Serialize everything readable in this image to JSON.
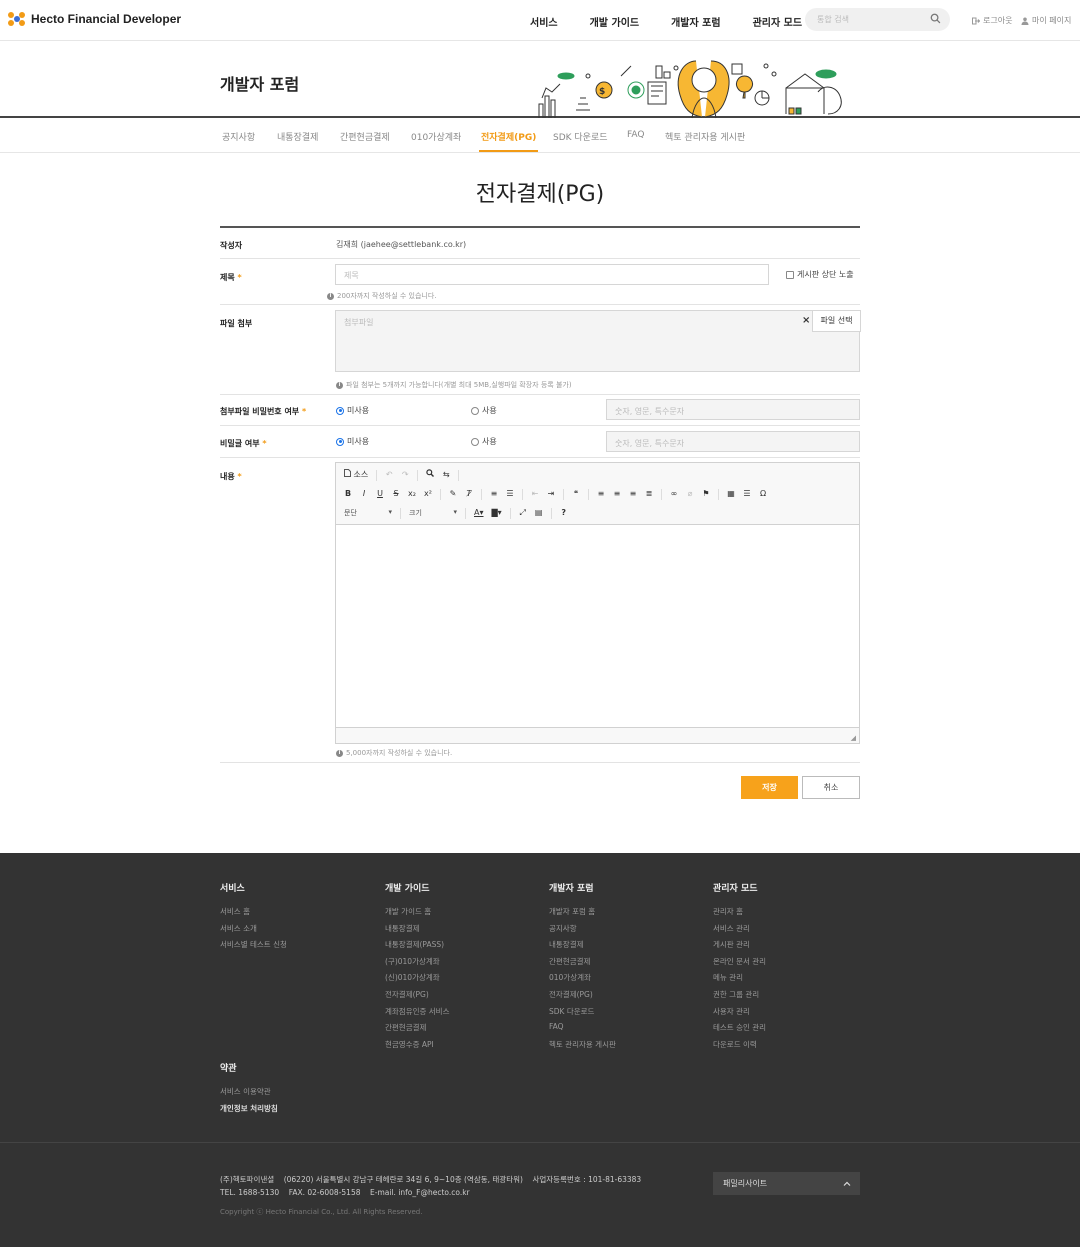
{
  "header": {
    "logo_text": "Hecto Financial Developer",
    "nav": [
      "서비스",
      "개발 가이드",
      "개발자 포럼",
      "관리자 모드"
    ],
    "search_placeholder": "통합 검색",
    "logout": "로그아웃",
    "mypage": "마이 페이지"
  },
  "page_title": "개발자 포럼",
  "tabs": [
    {
      "label": "공지사항",
      "active": false
    },
    {
      "label": "내통장결제",
      "active": false
    },
    {
      "label": "간편현금결제",
      "active": false
    },
    {
      "label": "010가상계좌",
      "active": false
    },
    {
      "label": "전자결제(PG)",
      "active": true
    },
    {
      "label": "SDK 다운로드",
      "active": false
    },
    {
      "label": "FAQ",
      "active": false
    },
    {
      "label": "헥토 관리자용 게시판",
      "active": false
    }
  ],
  "board_title": "전자결제(PG)",
  "form": {
    "author_label": "작성자",
    "author_value": "김재희 (jaehee@settlebank.co.kr)",
    "title_label": "제목",
    "title_placeholder": "제목",
    "notice_top_label": "게시판 상단 노출",
    "title_hint": "200자까지 작성하실 수 있습니다.",
    "file_label": "파일 첨부",
    "file_placeholder": "첨부파일",
    "file_select": "파일 선택",
    "file_clear": "×",
    "file_hint": "파일 첨부는 5개까지 가능합니다(개별 최대 5MB,실행파일 확장자 등록 불가)",
    "file_pw_label": "첨부파일 비밀번호 여부",
    "file_pw_off": "미사용",
    "file_pw_on": "사용",
    "file_pw_placeholder": "숫자, 영문, 특수문자",
    "secret_label": "비밀글 여부",
    "secret_off": "미사용",
    "secret_on": "사용",
    "secret_placeholder": "숫자, 영문, 특수문자",
    "content_label": "내용",
    "content_hint": "5,000자까지 작성하실 수 있습니다.",
    "required_mark": "*"
  },
  "editor": {
    "source": "소스",
    "format_select": "문단",
    "size_select": "크기"
  },
  "buttons": {
    "save": "저장",
    "cancel": "취소"
  },
  "footer": {
    "columns": [
      {
        "title": "서비스",
        "links": [
          "서비스 홈",
          "서비스 소개",
          "서비스별 테스트 신청"
        ]
      },
      {
        "title": "개발 가이드",
        "links": [
          "개발 가이드 홈",
          "내통장결제",
          "내통장결제(PASS)",
          "(구)010가상계좌",
          "(신)010가상계좌",
          "전자결제(PG)",
          "계좌점유인증 서비스",
          "간편현금결제",
          "현금영수증 API"
        ]
      },
      {
        "title": "개발자 포럼",
        "links": [
          "개발자 포럼 홈",
          "공지사항",
          "내통장결제",
          "간편현금결제",
          "010가상계좌",
          "전자결제(PG)",
          "SDK 다운로드",
          "FAQ",
          "헥토 관리자용 게시판"
        ]
      },
      {
        "title": "관리자 모드",
        "links": [
          "관리자 홈",
          "서비스 관리",
          "게시판 관리",
          "온라인 문서 관리",
          "메뉴 관리",
          "권한 그룹 관리",
          "사용자 관리",
          "테스트 승인 관리",
          "다운로드 이력"
        ]
      }
    ],
    "terms_title": "약관",
    "terms_links": [
      "서비스 이용약관",
      "개인정보 처리방침"
    ],
    "company": "(주)헥토파이낸셜",
    "address": "(06220) 서울특별시 강남구 테헤란로 34길 6, 9~10층 (역삼동, 태광타워)",
    "biz_no": "사업자등록번호 : 101-81-63383",
    "tel": "TEL. 1688-5130",
    "fax": "FAX. 02-6008-5158",
    "email": "E-mail. info_F@hecto.co.kr",
    "copyright": "Copyright ⓒ Hecto Financial Co., Ltd. All Rights Reserved.",
    "family_site": "패밀리사이트"
  },
  "colors": {
    "accent": "#f29b16",
    "footer_bg": "#333333"
  }
}
